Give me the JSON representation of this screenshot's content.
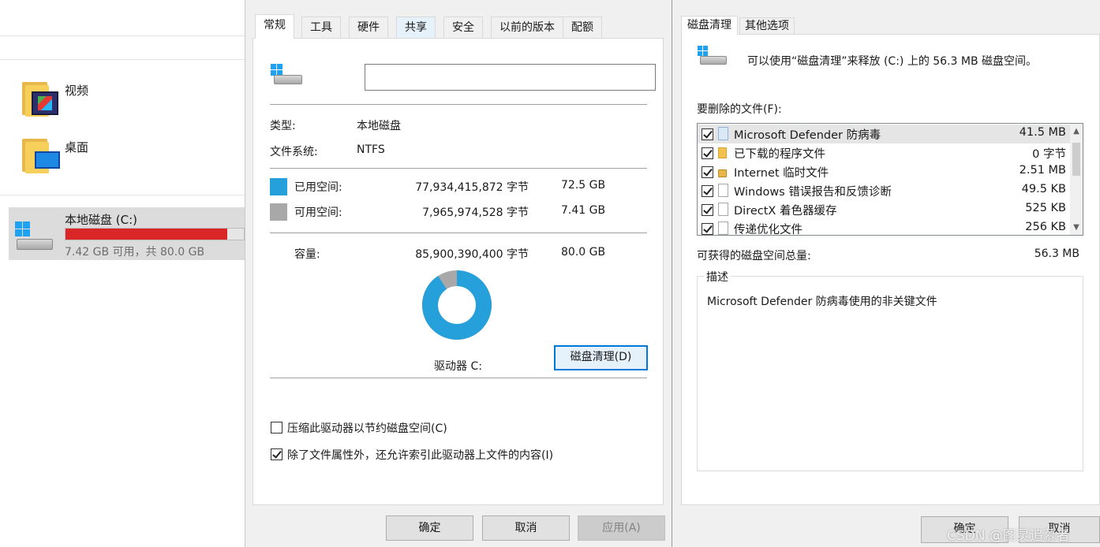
{
  "explorer": {
    "folders": [
      {
        "label": "视频",
        "icon": "video-folder-icon"
      },
      {
        "label": "桌面",
        "icon": "desktop-folder-icon"
      }
    ],
    "drive": {
      "label": "本地磁盘 (C:)",
      "usage_text": "7.42 GB 可用，共 80.0 GB",
      "used_fraction": 0.907,
      "bar_color": "#da2626"
    }
  },
  "properties": {
    "tabs": [
      "常规",
      "工具",
      "硬件",
      "共享",
      "安全",
      "以前的版本",
      "配额"
    ],
    "active_tab": "常规",
    "name_value": "",
    "type_label": "类型:",
    "type_value": "本地磁盘",
    "fs_label": "文件系统:",
    "fs_value": "NTFS",
    "used": {
      "label": "已用空间:",
      "bytes": "77,934,415,872 字节",
      "size": "72.5 GB",
      "color": "#26a0da"
    },
    "free": {
      "label": "可用空间:",
      "bytes": "7,965,974,528 字节",
      "size": "7.41 GB",
      "color": "#a8a8a8"
    },
    "capacity": {
      "label": "容量:",
      "bytes": "85,900,390,400 字节",
      "size": "80.0 GB"
    },
    "drive_label": "驱动器 C:",
    "cleanup_button": "磁盘清理(D)",
    "compress_checkbox": {
      "label": "压缩此驱动器以节约磁盘空间(C)",
      "checked": false
    },
    "index_checkbox": {
      "label": "除了文件属性外，还允许索引此驱动器上文件的内容(I)",
      "checked": true
    },
    "buttons": {
      "ok": "确定",
      "cancel": "取消",
      "apply": "应用(A)"
    },
    "used_fraction": 0.9073
  },
  "cleanup": {
    "tabs": [
      "磁盘清理",
      "其他选项"
    ],
    "active_tab": "磁盘清理",
    "intro": "可以使用“磁盘清理”来释放  (C:) 上的 56.3 MB 磁盘空间。",
    "files_label": "要删除的文件(F):",
    "files": [
      {
        "name": "Microsoft Defender 防病毒",
        "size": "41.5 MB",
        "checked": true,
        "icon": "file-icon"
      },
      {
        "name": "已下载的程序文件",
        "size": "0 字节",
        "checked": true,
        "icon": "folder-icon"
      },
      {
        "name": "Internet 临时文件",
        "size": "2.51 MB",
        "checked": true,
        "icon": "lock-icon"
      },
      {
        "name": "Windows 错误报告和反馈诊断",
        "size": "49.5 KB",
        "checked": true,
        "icon": "file-icon"
      },
      {
        "name": "DirectX 着色器缓存",
        "size": "525 KB",
        "checked": true,
        "icon": "file-icon"
      },
      {
        "name": "传递优化文件",
        "size": "256 KB",
        "checked": true,
        "icon": "file-icon"
      }
    ],
    "total_label": "可获得的磁盘空间总量:",
    "total_value": "56.3 MB",
    "desc_legend": "描述",
    "desc_text": "Microsoft Defender 防病毒使用的非关键文件",
    "buttons": {
      "ok": "确定",
      "cancel": "取消"
    },
    "watermark": "CSDN @图灵追慕者"
  }
}
